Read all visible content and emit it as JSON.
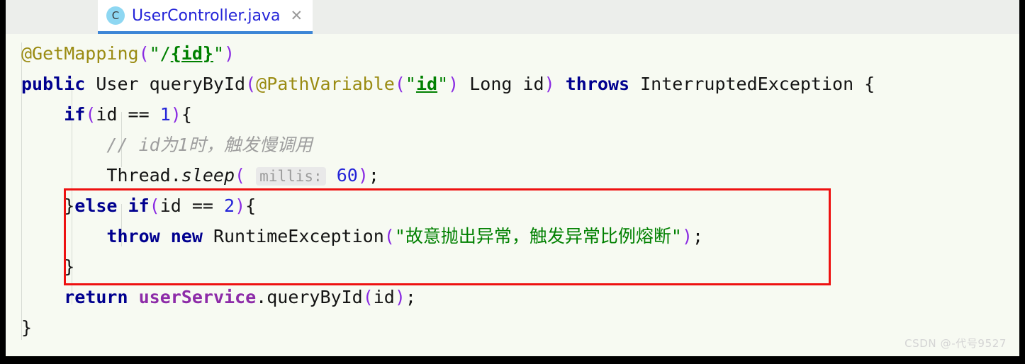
{
  "window": {
    "editor_background": "#f7faf2",
    "tabstrip_background": "#eceeeb",
    "accent": "#3d86d6",
    "highlight_box_color": "#ee1111"
  },
  "tab": {
    "icon_letter": "C",
    "filename": "UserController.java",
    "close_glyph": "✕"
  },
  "code": {
    "language": "java",
    "lines": [
      {
        "n": 1,
        "text": "@GetMapping(\"/{id}\")",
        "tokens": [
          {
            "t": "@GetMapping",
            "c": "anno"
          },
          {
            "t": "(",
            "c": "punct"
          },
          {
            "t": "\"/",
            "c": "str"
          },
          {
            "t": "{id}",
            "c": "strid"
          },
          {
            "t": "\"",
            "c": "str"
          },
          {
            "t": ")",
            "c": "punct"
          }
        ]
      },
      {
        "n": 2,
        "text": "public User queryById(@PathVariable(\"id\") Long id) throws InterruptedException {",
        "tokens": [
          {
            "t": "public",
            "c": "kw"
          },
          {
            "t": " User queryById",
            "c": "plain"
          },
          {
            "t": "(",
            "c": "punct"
          },
          {
            "t": "@PathVariable",
            "c": "anno"
          },
          {
            "t": "(",
            "c": "punct"
          },
          {
            "t": "\"",
            "c": "str"
          },
          {
            "t": "id",
            "c": "strid"
          },
          {
            "t": "\"",
            "c": "str"
          },
          {
            "t": ")",
            "c": "punct"
          },
          {
            "t": " Long id",
            "c": "plain"
          },
          {
            "t": ")",
            "c": "punct"
          },
          {
            "t": " ",
            "c": "plain"
          },
          {
            "t": "throws",
            "c": "kw"
          },
          {
            "t": " InterruptedException {",
            "c": "plain"
          }
        ]
      },
      {
        "n": 3,
        "text": "    if(id == 1){",
        "tokens": [
          {
            "t": "    ",
            "c": "plain"
          },
          {
            "t": "if",
            "c": "kw"
          },
          {
            "t": "(",
            "c": "punct"
          },
          {
            "t": "id == ",
            "c": "plain"
          },
          {
            "t": "1",
            "c": "num"
          },
          {
            "t": ")",
            "c": "punct"
          },
          {
            "t": "{",
            "c": "plain"
          }
        ]
      },
      {
        "n": 4,
        "text": "        // id为1时，触发慢调用",
        "tokens": [
          {
            "t": "        ",
            "c": "plain"
          },
          {
            "t": "// id为1时，触发慢调用",
            "c": "cmt"
          }
        ]
      },
      {
        "n": 5,
        "text": "        Thread.sleep( millis: 60);",
        "tokens": [
          {
            "t": "        Thread.",
            "c": "plain"
          },
          {
            "t": "sleep",
            "c": "ital"
          },
          {
            "t": "(",
            "c": "punct"
          },
          {
            "t": " ",
            "c": "plain"
          },
          {
            "t": "millis:",
            "c": "hint"
          },
          {
            "t": " ",
            "c": "plain"
          },
          {
            "t": "60",
            "c": "num"
          },
          {
            "t": ")",
            "c": "punct"
          },
          {
            "t": ";",
            "c": "plain"
          }
        ]
      },
      {
        "n": 6,
        "text": "    }else if(id == 2){",
        "tokens": [
          {
            "t": "    }",
            "c": "plain"
          },
          {
            "t": "else if",
            "c": "kw"
          },
          {
            "t": "(",
            "c": "punct"
          },
          {
            "t": "id == ",
            "c": "plain"
          },
          {
            "t": "2",
            "c": "num"
          },
          {
            "t": ")",
            "c": "punct"
          },
          {
            "t": "{",
            "c": "plain"
          }
        ]
      },
      {
        "n": 7,
        "text": "        throw new RuntimeException(\"故意抛出异常，触发异常比例熔断\");",
        "tokens": [
          {
            "t": "        ",
            "c": "plain"
          },
          {
            "t": "throw new",
            "c": "kw"
          },
          {
            "t": " RuntimeException",
            "c": "plain"
          },
          {
            "t": "(",
            "c": "punct"
          },
          {
            "t": "\"故意抛出异常，触发异常比例熔断\"",
            "c": "str"
          },
          {
            "t": ")",
            "c": "punct"
          },
          {
            "t": ";",
            "c": "plain"
          }
        ]
      },
      {
        "n": 8,
        "text": "    }",
        "tokens": [
          {
            "t": "    }",
            "c": "plain"
          }
        ]
      },
      {
        "n": 9,
        "text": "    return userService.queryById(id);",
        "tokens": [
          {
            "t": "    ",
            "c": "plain"
          },
          {
            "t": "return",
            "c": "kw"
          },
          {
            "t": " ",
            "c": "plain"
          },
          {
            "t": "userService",
            "c": "field"
          },
          {
            "t": ".queryById",
            "c": "plain"
          },
          {
            "t": "(",
            "c": "punct"
          },
          {
            "t": "id",
            "c": "plain"
          },
          {
            "t": ")",
            "c": "punct"
          },
          {
            "t": ";",
            "c": "plain"
          }
        ]
      },
      {
        "n": 10,
        "text": "}",
        "tokens": [
          {
            "t": "}",
            "c": "plain"
          }
        ]
      }
    ]
  },
  "annotation": {
    "highlight_note": "red rectangle around the else-if branch that throws RuntimeException",
    "covers_lines": [
      6,
      7,
      8
    ]
  },
  "watermark": {
    "text": "CSDN @-代号9527"
  }
}
